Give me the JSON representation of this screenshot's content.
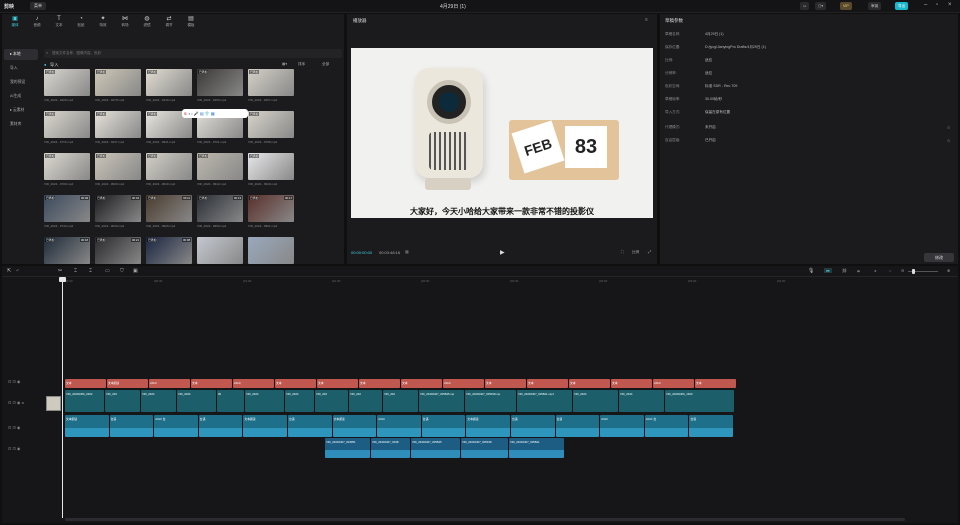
{
  "app": {
    "logo": "剪映",
    "menu": "菜单",
    "title": "4月29日 (1)",
    "vip": "VIP",
    "share": "审阅",
    "export": "导出"
  },
  "toolbar": {
    "tools": [
      {
        "label": "媒体",
        "icon": "▣",
        "active": true
      },
      {
        "label": "音频",
        "icon": "♪"
      },
      {
        "label": "文本",
        "icon": "T"
      },
      {
        "label": "贴纸",
        "icon": "◔"
      },
      {
        "label": "特效",
        "icon": "✦"
      },
      {
        "label": "转场",
        "icon": "⋈"
      },
      {
        "label": "滤镜",
        "icon": "◍"
      },
      {
        "label": "调节",
        "icon": "⇄"
      },
      {
        "label": "模板",
        "icon": "▤"
      }
    ]
  },
  "sidebar": {
    "items": [
      {
        "label": "▸ 本地",
        "active": true
      },
      {
        "label": "导入"
      },
      {
        "label": "我的预设"
      },
      {
        "label": "AI生成"
      },
      {
        "label": "▸ 云素材"
      },
      {
        "label": "素材库"
      }
    ]
  },
  "search": {
    "placeholder": "搜索文件名称、图像内容、色彩"
  },
  "media": {
    "import_label": "导入",
    "sort_label": "排序",
    "filter_label": "全部",
    "section": "全部",
    "thumbs": [
      {
        "name": "VID_2024...0429.mp4",
        "badge": "",
        "added": "已添加",
        "color": "#d9d6cf"
      },
      {
        "name": "VID_2024...0478.mp4",
        "badge": "",
        "added": "已添加",
        "color": "#cfc8b8"
      },
      {
        "name": "VID_2024...0440.mp4",
        "badge": "",
        "added": "已添加",
        "color": "#e2ddd2"
      },
      {
        "name": "VID_2024...0460.mp4",
        "badge": "",
        "added": "已添加",
        "color": "#3b3937"
      },
      {
        "name": "VID_2024...0257.mp4",
        "badge": "",
        "added": "已添加",
        "color": "#d5d1c8"
      },
      {
        "name": "VID_2024...0715.mp4",
        "badge": "",
        "added": "已添加",
        "color": "#dcd8cf"
      },
      {
        "name": "VID_2024...0237.mp4",
        "badge": "",
        "added": "已添加",
        "color": "#e6e2da"
      },
      {
        "name": "VID_2024...0931.mp4",
        "badge": "",
        "added": "已添加",
        "color": "#e9e6df"
      },
      {
        "name": "VID_2024...0701.mp4",
        "badge": "",
        "added": "已添加",
        "color": "#e2dfd8"
      },
      {
        "name": "VID_2024...0798.mp4",
        "badge": "",
        "added": "已添加",
        "color": "#d8d4ca"
      },
      {
        "name": "VID_2024...0709.mp4",
        "badge": "",
        "added": "已添加",
        "color": "#ddd9d1"
      },
      {
        "name": "VID_2024...0909.mp4",
        "badge": "",
        "added": "已添加",
        "color": "#cbc5b9"
      },
      {
        "name": "VID_2024...0640.mp4",
        "badge": "",
        "added": "已添加",
        "color": "#d3cfc6"
      },
      {
        "name": "VID_2024...0942.mp4",
        "badge": "",
        "added": "已添加",
        "color": "#bdb8ae"
      },
      {
        "name": "VID_2024...0949.mp4",
        "badge": "",
        "added": "已添加",
        "color": "#e8e8ea"
      },
      {
        "name": "VID_2024...0744.mp4",
        "badge": "00:09",
        "added": "已添加",
        "color": "#3c4a5e"
      },
      {
        "name": "VID_2024...0049.mp4",
        "badge": "00:04",
        "added": "已添加",
        "color": "#1d1d20"
      },
      {
        "name": "VID_2024...0929.mp4",
        "badge": "00:11",
        "added": "已添加",
        "color": "#4a3c2f"
      },
      {
        "name": "VID_2024...0960.mp4",
        "badge": "00:13",
        "added": "已添加",
        "color": "#2b2f36"
      },
      {
        "name": "VID_2024...0961.mp4",
        "badge": "00:17",
        "added": "已添加",
        "color": "#5a2f2a"
      },
      {
        "name": "VID_2024...0002.mp4",
        "badge": "00:18",
        "added": "已添加",
        "color": "#1f2b3a"
      },
      {
        "name": "VID_2024...0003.mp4",
        "badge": "00:21",
        "added": "已添加",
        "color": "#2a2a2e"
      },
      {
        "name": "VID_2024...0004.mp4",
        "badge": "00:08",
        "added": "已添加",
        "color": "#1a2540"
      },
      {
        "name": "VID_2024...0005.mp4",
        "badge": "",
        "added": "",
        "color": "#c4c8cf"
      },
      {
        "name": "VID_2024...0006.mp4",
        "badge": "",
        "added": "",
        "color": "#9aa9bd"
      }
    ]
  },
  "player": {
    "title": "播放器",
    "subtitle": "大家好，今天小哈给大家带来一款非常不错的投影仪",
    "current": "00:00:00:00",
    "total": "00:03:48:16",
    "ratio": "比例",
    "calendar": "FEB 83"
  },
  "params": {
    "title": "草稿参数",
    "rows": [
      {
        "k": "草稿名称:",
        "v": "4月29日 (1)"
      },
      {
        "k": "保存位置:",
        "v": "D:/jycg/JianyingPro Drafts/4月29日 (1)"
      },
      {
        "k": "比例:",
        "v": "适应"
      },
      {
        "k": "分辨率:",
        "v": "适应"
      },
      {
        "k": "色彩空间:",
        "v": "标准 SDR - Rec.709"
      },
      {
        "k": "草稿帧率:",
        "v": "30.00帧/秒"
      },
      {
        "k": "导入方式:",
        "v": "保留在原有位置"
      },
      {
        "k": "代理模式:",
        "v": "未开启"
      },
      {
        "k": "自由层级:",
        "v": "已开启"
      }
    ],
    "edit": "修改"
  },
  "timeline": {
    "ruler": [
      "00:00",
      "|00:30",
      "|01:00",
      "|01:30",
      "|02:00",
      "|02:30",
      "|03:00",
      "|03:30",
      "|04:00"
    ],
    "colors": {
      "text": "#c0584f",
      "video": "#1c5f6b",
      "audio1": "#1e6f8a",
      "audio2": "#1d5d83",
      "accent": "#3ed3e6"
    },
    "text_track": [
      "文本",
      "文本朗读",
      "AIGC",
      "文本",
      "AIGC",
      "文本",
      "文本",
      "文本",
      "文本",
      "AIGC",
      "文本",
      "文本",
      "文本",
      "文本",
      "AIGC",
      "文本"
    ],
    "video_track": [
      "VID_20240406_0302",
      "VID_202",
      "VID_2024",
      "VID_2024",
      "00",
      "VID_2024",
      "VID_2024",
      "VID_202",
      "VID_202",
      "VID_202",
      "VID_20240407_005845.mp",
      "VID_20240407_005918.mp",
      "VID_20240407_005821.mp4",
      "VID_2024",
      "VID_2024",
      "VID_20240406_1300"
    ],
    "audio_track1": [
      "文本朗读",
      "台语",
      "AIGC 台",
      "台语",
      "文本朗读",
      "台语",
      "文本朗读",
      "AIGC",
      "台语",
      "文本朗读",
      "台语",
      "台语",
      "AIGC",
      "AIGC 台",
      "台语"
    ],
    "audio_track2": [
      "VID_20240407_004951",
      "VID_20240407_0048",
      "VID_20240407_005845",
      "VID_20240407_005918",
      "VID_20240407_005821"
    ]
  }
}
